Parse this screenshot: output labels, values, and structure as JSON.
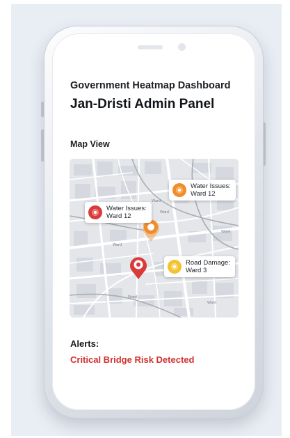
{
  "header": {
    "subtitle": "Government Heatmap Dashboard",
    "title": "Jan-Dristi Admin Panel"
  },
  "map_view": {
    "section_title": "Map View",
    "callouts": [
      {
        "text": "Water Issues: Ward 12",
        "line1": "Water Issues:",
        "line2": "Ward 12",
        "color": "#f28c28"
      },
      {
        "text": "Water Issues: Ward 12",
        "line1": "Water Issues:",
        "line2": "Ward 12",
        "color": "#d93a3a"
      },
      {
        "text": "Road Damage: Ward 3",
        "line1": "Road Damage:",
        "line2": "Ward 3",
        "color": "#f2c230"
      }
    ],
    "street_labels": [
      "Ward",
      "Ward",
      "Ward",
      "Ward",
      "Ward",
      "Ward"
    ]
  },
  "alerts": {
    "heading": "Alerts:",
    "items": [
      {
        "text": "Critical Bridge Risk Detected",
        "color": "#d12f2f"
      }
    ]
  },
  "colors": {
    "alert_red": "#d12f2f",
    "pin_red": "#d93a3a",
    "pin_orange": "#f28c28",
    "pin_yellow": "#f2c230",
    "map_background": "#e4e6ea"
  }
}
